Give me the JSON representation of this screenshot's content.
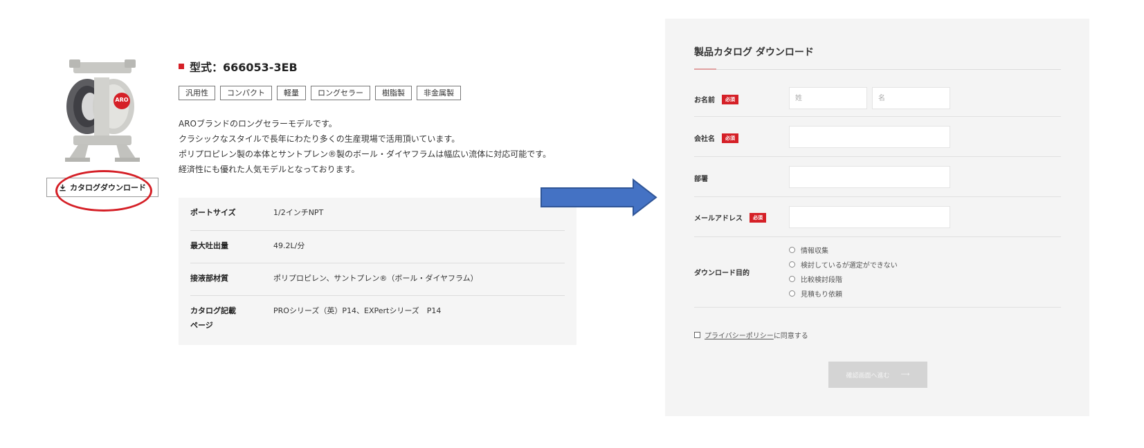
{
  "product": {
    "logo_text": "ARO",
    "download_button": "カタログダウンロード",
    "model_title": "型式：666053-3EB",
    "tags": [
      "汎用性",
      "コンパクト",
      "軽量",
      "ロングセラー",
      "樹脂製",
      "非金属製"
    ],
    "description": [
      "AROブランドのロングセラーモデルです。",
      "クラシックなスタイルで長年にわたり多くの生産現場で活用頂いています。",
      "ポリプロピレン製の本体とサントプレン®製のボール・ダイヤフラムは幅広い流体に対応可能です。",
      "経済性にも優れた人気モデルとなっております。"
    ],
    "specs": [
      {
        "label": "ポートサイズ",
        "value": "1/2インチNPT"
      },
      {
        "label": "最大吐出量",
        "value": "49.2L/分"
      },
      {
        "label": "接液部材質",
        "value": "ポリプロピレン、サントプレン®（ボール・ダイヤフラム）"
      },
      {
        "label_line1": "カタログ記載",
        "label_line2": "ページ",
        "value": "PROシリーズ（英）P14、EXPertシリーズ　P14"
      }
    ]
  },
  "form": {
    "title": "製品カタログ ダウンロード",
    "required_badge": "必須",
    "name_label": "お名前",
    "last_name_placeholder": "姓",
    "first_name_placeholder": "名",
    "company_label": "会社名",
    "department_label": "部署",
    "email_label": "メールアドレス",
    "purpose_label": "ダウンロード目的",
    "purpose_options": [
      "情報収集",
      "検討しているが選定ができない",
      "比較検討段階",
      "見積もり依頼"
    ],
    "privacy_link": "プライバシーポリシー",
    "privacy_suffix": "に同意する",
    "submit_label": "確認画面へ進む",
    "submit_arrow": "⟶"
  },
  "colors": {
    "accent_red": "#d52027",
    "arrow_blue": "#4472c4",
    "panel_bg": "#f4f4f4"
  }
}
